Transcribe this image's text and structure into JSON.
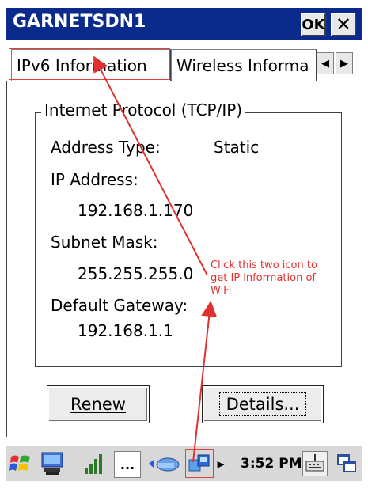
{
  "window": {
    "title": "GARNETSDN1",
    "ok_label": "OK",
    "close_label": "✕"
  },
  "tabs": [
    {
      "label": "IPv6 Information"
    },
    {
      "label": "Wireless Informa"
    }
  ],
  "group": {
    "title": "Internet Protocol (TCP/IP)",
    "address_type_label": "Address Type:",
    "address_type_value": "Static",
    "ip_label": "IP Address:",
    "ip_value": "192.168.1.170",
    "subnet_label": "Subnet Mask:",
    "subnet_value": "255.255.255.0",
    "gateway_label": "Default Gateway:",
    "gateway_value": "192.168.1.1"
  },
  "buttons": {
    "renew": "Renew",
    "details": "Details..."
  },
  "taskbar": {
    "time": "3:52 PM",
    "more": "...",
    "expand_arrow": "▸"
  },
  "annotation": {
    "text": "Click this two icon to get IP information of WiFi",
    "color": "#e03030"
  },
  "colors": {
    "titlebar": "#0a2a8c",
    "accent_red": "#e04040"
  }
}
